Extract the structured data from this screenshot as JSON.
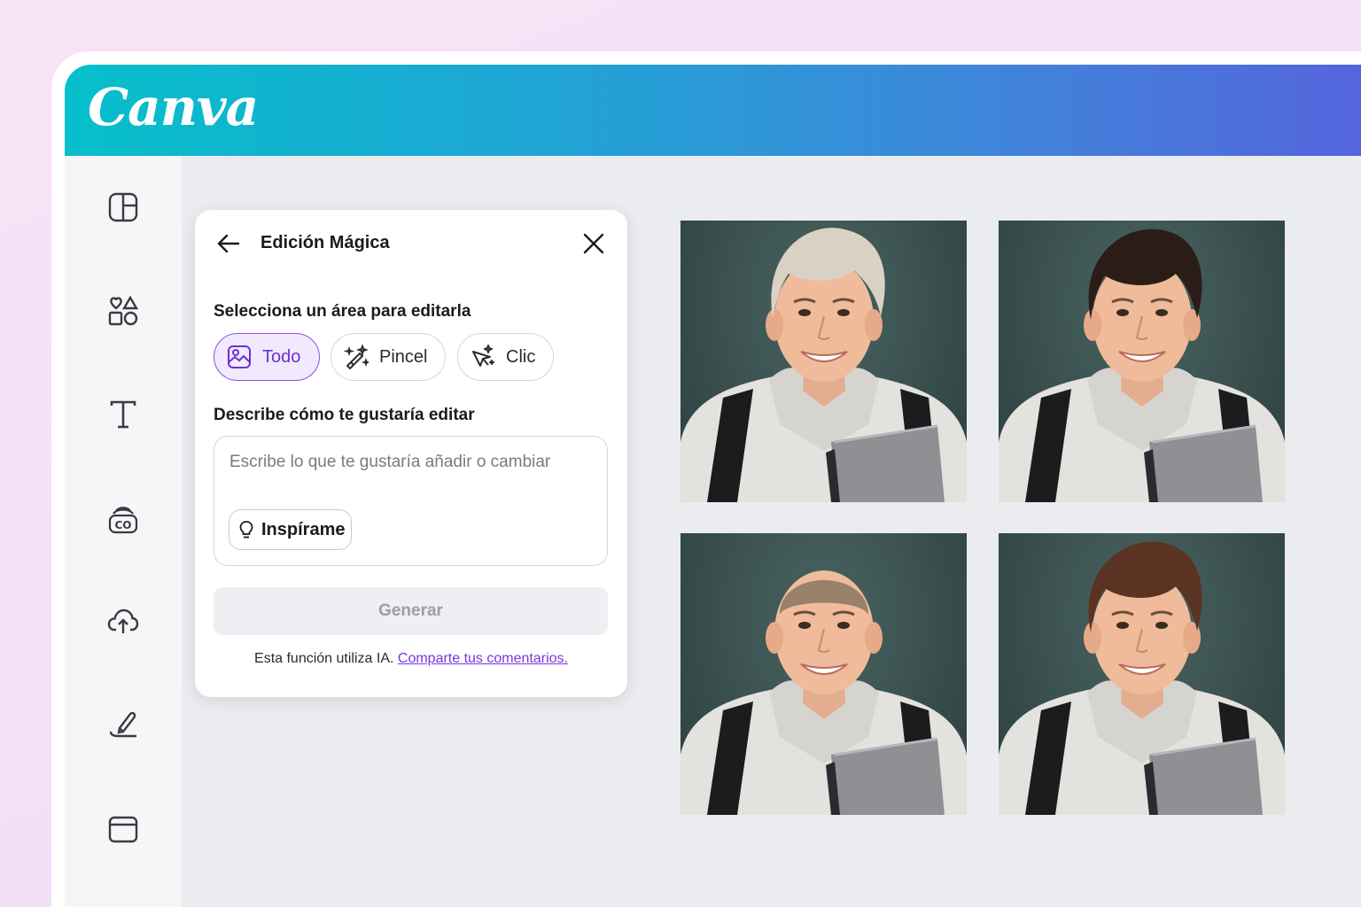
{
  "brand": {
    "logo_text": "Canva"
  },
  "sidebar": {
    "items": [
      {
        "icon": "layout-icon"
      },
      {
        "icon": "elements-icon"
      },
      {
        "icon": "text-icon"
      },
      {
        "icon": "brand-icon"
      },
      {
        "icon": "upload-cloud-icon"
      },
      {
        "icon": "draw-icon"
      },
      {
        "icon": "folder-icon"
      }
    ]
  },
  "panel": {
    "title": "Edición Mágica",
    "select_label": "Selecciona un área para editarla",
    "modes": [
      {
        "label": "Todo",
        "active": true
      },
      {
        "label": "Pincel",
        "active": false
      },
      {
        "label": "Clic",
        "active": false
      }
    ],
    "describe_label": "Describe cómo te gustaría editar",
    "placeholder": "Escribe lo que te gustaría añadir o cambiar",
    "inspire_label": "Inspírame",
    "generate_label": "Generar",
    "footnote_text": "Esta función utiliza IA.",
    "footnote_link": "Comparte tus comentarios."
  },
  "photos": [
    {
      "hair": "platinum-blond",
      "hair_color": "#d9d2c4"
    },
    {
      "hair": "dark-brown",
      "hair_color": "#2a1d16"
    },
    {
      "hair": "buzz-cut",
      "hair_color": "#8a7660"
    },
    {
      "hair": "auburn",
      "hair_color": "#5b3322"
    }
  ],
  "colors": {
    "accent": "#8f4ee8",
    "link": "#7b35de"
  }
}
